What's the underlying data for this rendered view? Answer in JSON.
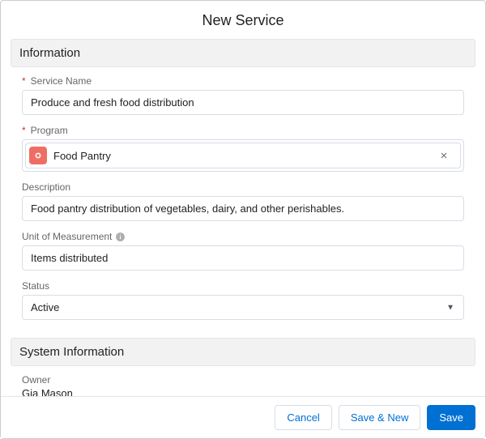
{
  "dialog": {
    "title": "New Service"
  },
  "sections": {
    "information": {
      "header": "Information",
      "fields": {
        "serviceName": {
          "label": "Service Name",
          "value": "Produce and fresh food distribution",
          "required": true
        },
        "program": {
          "label": "Program",
          "value": "Food Pantry",
          "required": true,
          "icon": "record-icon"
        },
        "description": {
          "label": "Description",
          "value": "Food pantry distribution of vegetables, dairy, and other perishables."
        },
        "unitOfMeasurement": {
          "label": "Unit of Measurement",
          "value": "Items distributed"
        },
        "status": {
          "label": "Status",
          "value": "Active"
        }
      }
    },
    "systemInformation": {
      "header": "System Information",
      "owner": {
        "label": "Owner",
        "value": "Gia Mason"
      }
    }
  },
  "footer": {
    "cancel": "Cancel",
    "saveNew": "Save & New",
    "save": "Save"
  }
}
